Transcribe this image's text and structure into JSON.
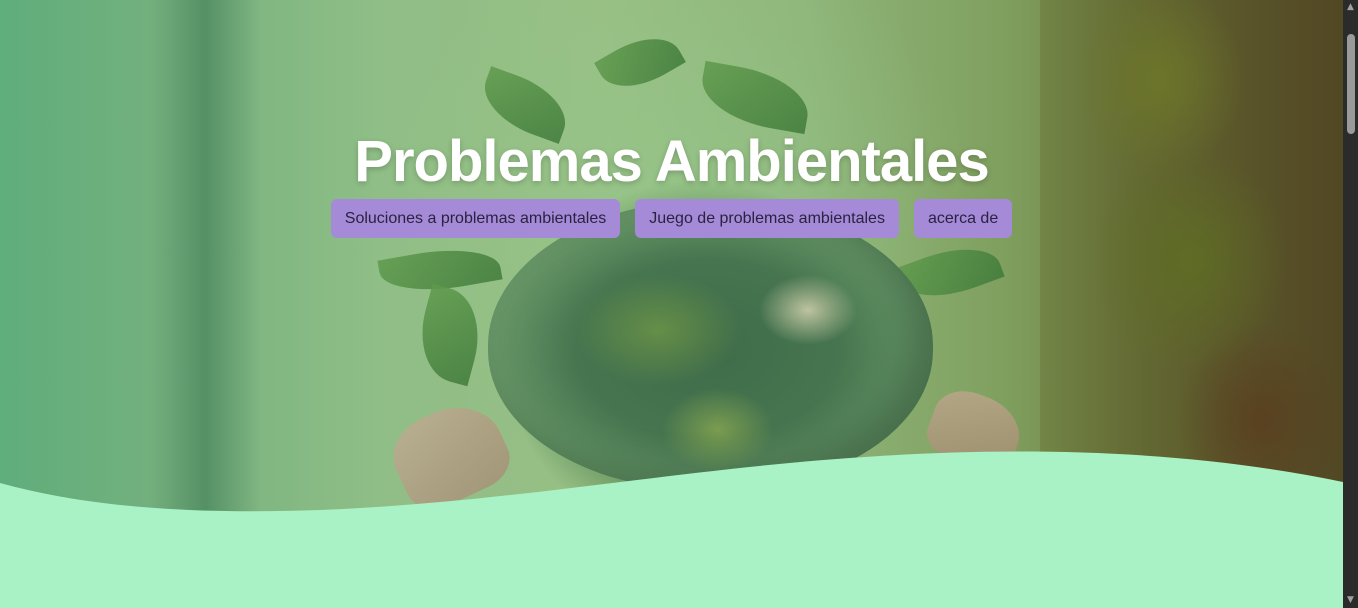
{
  "page": {
    "title": "Problemas Ambientales"
  },
  "nav": {
    "items": [
      {
        "label": "Soluciones a problemas ambientales"
      },
      {
        "label": "Juego de problemas ambientales"
      },
      {
        "label": "acerca de"
      }
    ]
  },
  "colors": {
    "nav_button_bg": "#a58ad8",
    "wave": "#a8f2c6",
    "title": "#ffffff"
  },
  "icons": {
    "scroll_up": "triangle-up",
    "scroll_down": "triangle-down"
  }
}
